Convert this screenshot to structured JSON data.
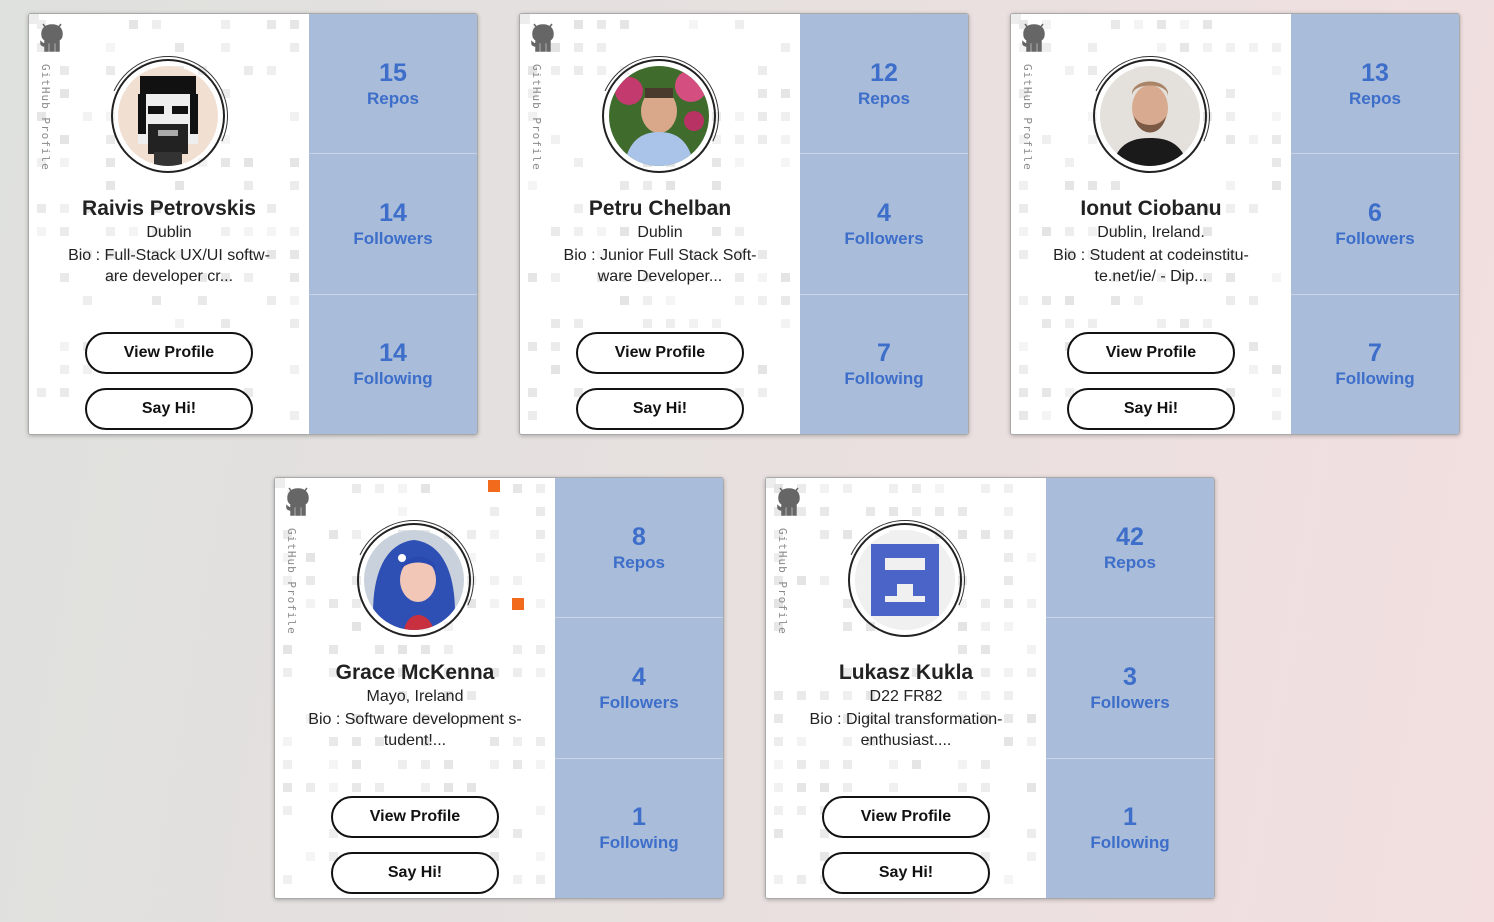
{
  "cards": [
    {
      "gh_label": "GitHub Profile",
      "name": "Raivis Petrovskis",
      "location": "Dublin",
      "bio": "Bio : Full-Stack UX/UI softw-are developer cr...",
      "bio_line1": "Bio : Full-Stack UX/UI softw-",
      "bio_line2": "are developer cr...",
      "repos": "15",
      "repos_label": "Repos",
      "followers": "14",
      "followers_label": "Followers",
      "following": "14",
      "following_label": "Following",
      "view_profile": "View Profile",
      "say_hi": "Say Hi!",
      "avatar_icon": "pixel-art-face-avatar"
    },
    {
      "gh_label": "GitHub Profile",
      "name": "Petru Chelban",
      "location": "Dublin",
      "bio_line1": "Bio : Junior Full Stack Soft-",
      "bio_line2": "ware Developer...",
      "repos": "12",
      "repos_label": "Repos",
      "followers": "4",
      "followers_label": "Followers",
      "following": "7",
      "following_label": "Following",
      "view_profile": "View Profile",
      "say_hi": "Say Hi!",
      "avatar_icon": "photo-avatar"
    },
    {
      "gh_label": "GitHub Profile",
      "name": "Ionut Ciobanu",
      "location": "Dublin, Ireland.",
      "bio_line1": "Bio : Student at codeinstitu-",
      "bio_line2": "te.net/ie/ - Dip...",
      "repos": "13",
      "repos_label": "Repos",
      "followers": "6",
      "followers_label": "Followers",
      "following": "7",
      "following_label": "Following",
      "view_profile": "View Profile",
      "say_hi": "Say Hi!",
      "avatar_icon": "photo-avatar"
    },
    {
      "gh_label": "GitHub Profile",
      "name": "Grace McKenna",
      "location": "Mayo, Ireland",
      "bio_line1": "Bio : Software development s-",
      "bio_line2": "tudent!...",
      "repos": "8",
      "repos_label": "Repos",
      "followers": "4",
      "followers_label": "Followers",
      "following": "1",
      "following_label": "Following",
      "view_profile": "View Profile",
      "say_hi": "Say Hi!",
      "avatar_icon": "photo-avatar"
    },
    {
      "gh_label": "GitHub Profile",
      "name": "Lukasz Kukla",
      "location": "D22 FR82",
      "bio_line1": "Bio : Digital transformation-",
      "bio_line2": "enthusiast....",
      "repos": "42",
      "repos_label": "Repos",
      "followers": "3",
      "followers_label": "Followers",
      "following": "1",
      "following_label": "Following",
      "view_profile": "View Profile",
      "say_hi": "Say Hi!",
      "avatar_icon": "identicon-avatar"
    }
  ],
  "colors": {
    "stat_panel": "#a9bcd9",
    "stat_text": "#3d6ec9",
    "accent_orange": "#f26a1b"
  }
}
